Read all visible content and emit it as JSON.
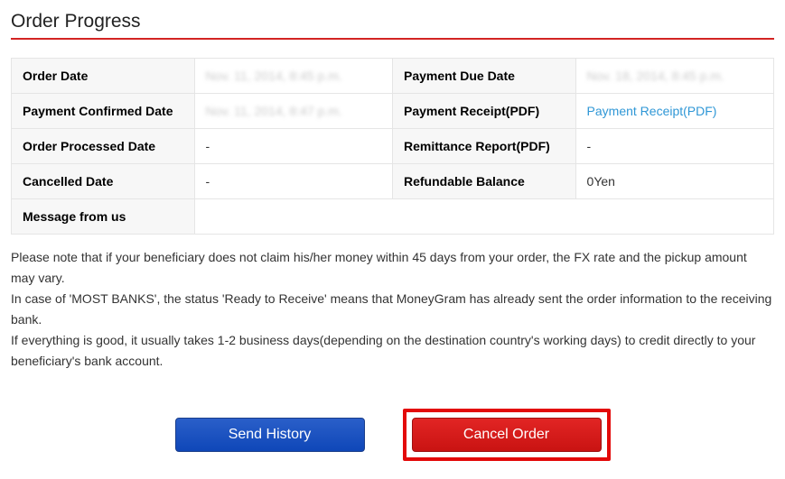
{
  "title": "Order Progress",
  "table": {
    "row1": {
      "label1": "Order Date",
      "value1": "Nov. 11, 2014, 8:45 p.m.",
      "label2": "Payment Due Date",
      "value2": "Nov. 18, 2014, 8:45 p.m."
    },
    "row2": {
      "label1": "Payment Confirmed Date",
      "value1": "Nov. 11, 2014, 8:47 p.m.",
      "label2": "Payment Receipt(PDF)",
      "value2_link": "Payment Receipt(PDF)"
    },
    "row3": {
      "label1": "Order Processed Date",
      "value1": "-",
      "label2": "Remittance Report(PDF)",
      "value2": "-"
    },
    "row4": {
      "label1": "Cancelled Date",
      "value1": "-",
      "label2": "Refundable Balance",
      "value2": "0Yen"
    },
    "row5": {
      "label1": "Message from us",
      "value1": ""
    }
  },
  "notes": "Please note that if your beneficiary does not claim his/her money within 45 days from your order, the FX rate and the pickup amount may vary.\nIn case of 'MOST BANKS', the status 'Ready to Receive' means that MoneyGram has already sent the order information to the receiving bank.\nIf everything is good, it usually takes 1-2 business days(depending on the destination country's working days) to credit directly to your beneficiary's bank account.",
  "buttons": {
    "send_history": "Send History",
    "cancel_order": "Cancel Order"
  }
}
